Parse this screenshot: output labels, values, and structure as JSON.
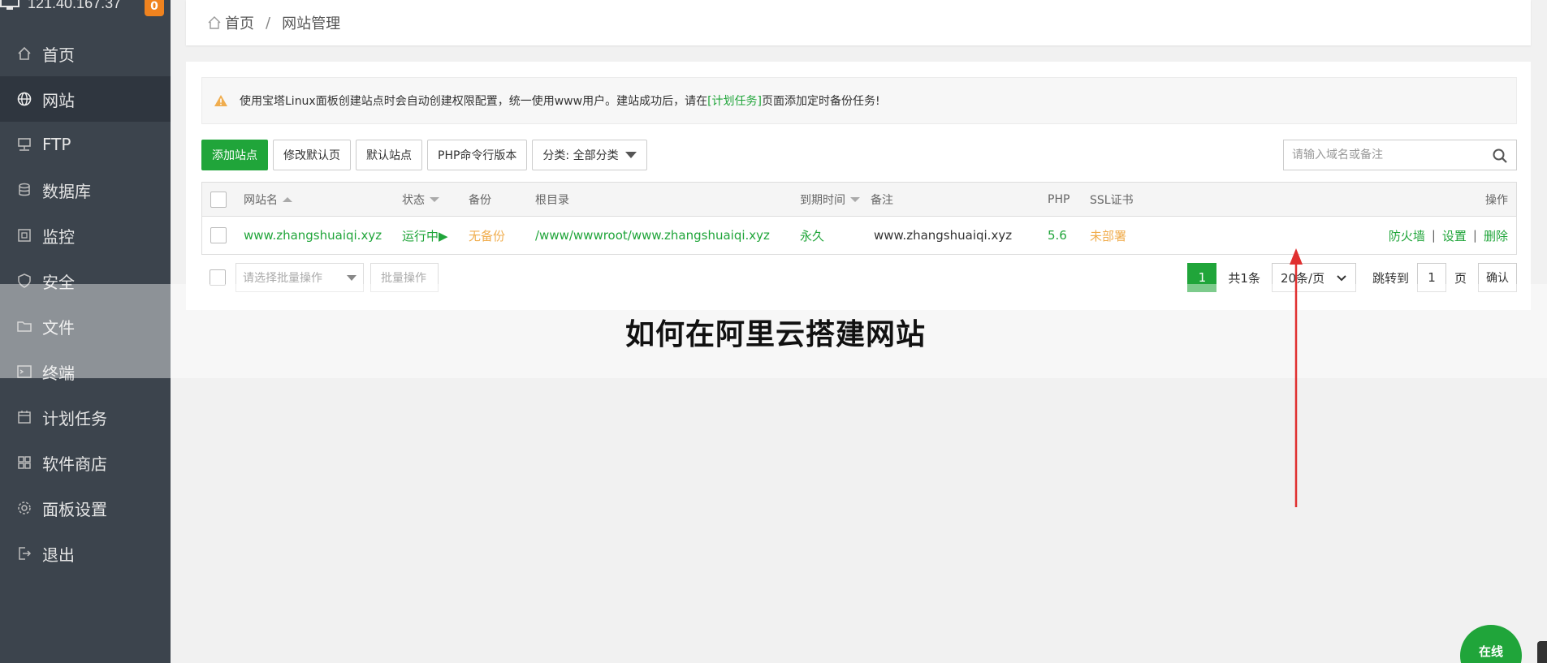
{
  "sidebar": {
    "ip": "121.40.167.37",
    "badge": "0",
    "items": [
      {
        "label": "首页",
        "icon": "home-icon"
      },
      {
        "label": "网站",
        "icon": "globe-icon"
      },
      {
        "label": "FTP",
        "icon": "ftp-icon"
      },
      {
        "label": "数据库",
        "icon": "database-icon"
      },
      {
        "label": "监控",
        "icon": "monitor-icon"
      },
      {
        "label": "安全",
        "icon": "shield-icon"
      },
      {
        "label": "文件",
        "icon": "folder-icon"
      },
      {
        "label": "终端",
        "icon": "terminal-icon"
      },
      {
        "label": "计划任务",
        "icon": "calendar-icon"
      },
      {
        "label": "软件商店",
        "icon": "apps-icon"
      },
      {
        "label": "面板设置",
        "icon": "gear-icon"
      },
      {
        "label": "退出",
        "icon": "logout-icon"
      }
    ]
  },
  "breadcrumb": {
    "home": "首页",
    "sep": "/",
    "current": "网站管理"
  },
  "notice": {
    "before": "使用宝塔Linux面板创建站点时会自动创建权限配置，统一使用www用户。建站成功后，请在",
    "link": "[计划任务]",
    "after": "页面添加定时备份任务!"
  },
  "toolbar": {
    "add_site": "添加站点",
    "edit_default_page": "修改默认页",
    "default_site": "默认站点",
    "php_cli": "PHP命令行版本",
    "category": "分类: 全部分类"
  },
  "search": {
    "placeholder": "请输入域名或备注"
  },
  "table": {
    "headers": {
      "name": "网站名",
      "status": "状态",
      "backup": "备份",
      "root": "根目录",
      "expire": "到期时间",
      "remark": "备注",
      "php": "PHP",
      "ssl": "SSL证书",
      "actions": "操作"
    },
    "rows": [
      {
        "name": "www.zhangshuaiqi.xyz",
        "status": "运行中▶",
        "backup": "无备份",
        "root": "/www/wwwroot/www.zhangshuaiqi.xyz",
        "expire": "永久",
        "remark": "www.zhangshuaiqi.xyz",
        "php": "5.6",
        "ssl": "未部署",
        "actions": {
          "firewall": "防火墙",
          "settings": "设置",
          "delete": "删除",
          "sep": "|"
        }
      }
    ]
  },
  "bulk": {
    "select_placeholder": "请选择批量操作",
    "apply": "批量操作"
  },
  "pagination": {
    "current": "1",
    "total": "共1条",
    "page_size": "20条/页",
    "jump_label": "跳转到",
    "jump_value": "1",
    "page_unit": "页",
    "confirm": "确认"
  },
  "overlay_title": "如何在阿里云搭建网站",
  "chat": {
    "label": "在线"
  },
  "colors": {
    "sidebar": "#3c444d",
    "accent": "#20a53a",
    "warning": "#f0ad4e",
    "badge": "#f0831f",
    "arrow": "#e03030"
  }
}
